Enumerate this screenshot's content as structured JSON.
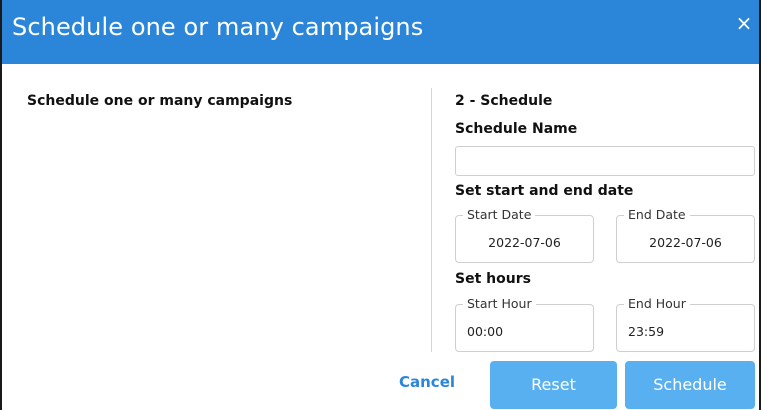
{
  "dialog": {
    "title": "Schedule one or many campaigns",
    "close_glyph": "×",
    "close_icon": "close-icon"
  },
  "left_panel": {
    "title": "Schedule one or many campaigns"
  },
  "schedule": {
    "step_title": "2 - Schedule",
    "name_label": "Schedule Name",
    "name_value": "",
    "dates_label": "Set start and end date",
    "start_date_label": "Start Date",
    "start_date_value": "2022-07-06",
    "end_date_label": "End Date",
    "end_date_value": "2022-07-06",
    "hours_label": "Set hours",
    "start_hour_label": "Start Hour",
    "start_hour_value": "00:00",
    "end_hour_label": "End Hour",
    "end_hour_value": "23:59"
  },
  "actions": {
    "cancel_label": "Cancel",
    "reset_label": "Reset",
    "schedule_label": "Schedule"
  },
  "colors": {
    "header_blue": "#2b86d9",
    "button_blue": "#58b0f0",
    "link_blue": "#2b86d9"
  }
}
